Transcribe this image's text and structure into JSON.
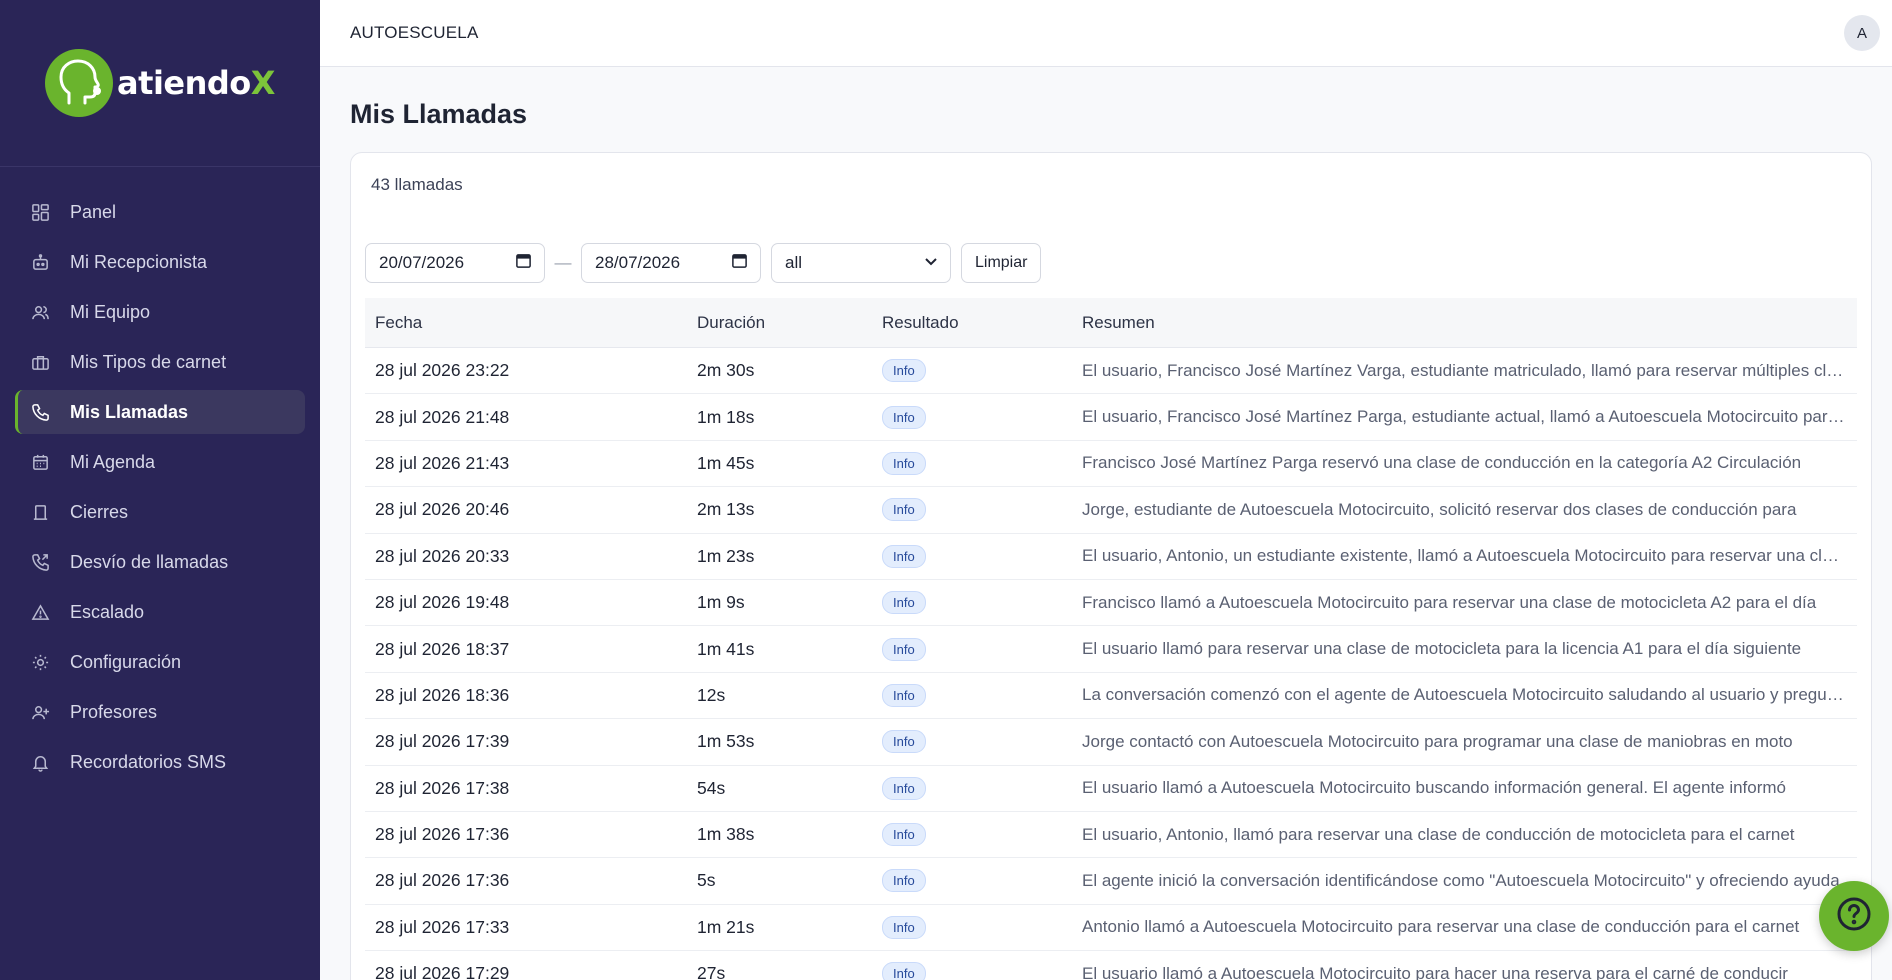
{
  "brand": {
    "name_main": "atiendo",
    "name_accent": "X",
    "accent_color": "#6ab42d",
    "sidebar_bg": "#2a2557"
  },
  "sidebar": {
    "items": [
      {
        "label": "Panel",
        "icon": "dashboard-grid-icon",
        "active": false
      },
      {
        "label": "Mi Recepcionista",
        "icon": "robot-icon",
        "active": false
      },
      {
        "label": "Mi Equipo",
        "icon": "users-icon",
        "active": false
      },
      {
        "label": "Mis Tipos de carnet",
        "icon": "briefcase-icon",
        "active": false
      },
      {
        "label": "Mis Llamadas",
        "icon": "phone-icon",
        "active": true
      },
      {
        "label": "Mi Agenda",
        "icon": "calendar-icon",
        "active": false
      },
      {
        "label": "Cierres",
        "icon": "building-icon",
        "active": false
      },
      {
        "label": "Desvío de llamadas",
        "icon": "phone-forward-icon",
        "active": false
      },
      {
        "label": "Escalado",
        "icon": "warning-triangle-icon",
        "active": false
      },
      {
        "label": "Configuración",
        "icon": "gear-icon",
        "active": false
      },
      {
        "label": "Profesores",
        "icon": "user-plus-icon",
        "active": false
      },
      {
        "label": "Recordatorios SMS",
        "icon": "bell-icon",
        "active": false
      }
    ]
  },
  "header": {
    "org_name": "AUTOESCUELA",
    "avatar_initial": "A"
  },
  "main": {
    "title": "Mis Llamadas",
    "count_label": "43 llamadas",
    "filters": {
      "date_from": "20/07/2026",
      "date_to": "28/07/2026",
      "separator": "—",
      "result_select": "all",
      "clear_label": "Limpiar"
    },
    "table": {
      "headers": [
        "Fecha",
        "Duración",
        "Resultado",
        "Resumen"
      ],
      "rows": [
        {
          "fecha": "28 jul 2026 23:22",
          "duracion": "2m 30s",
          "resultado": "Info",
          "resumen": "El usuario, Francisco José Martínez Varga, estudiante matriculado, llamó para reservar múltiples clases de conducción"
        },
        {
          "fecha": "28 jul 2026 21:48",
          "duracion": "1m 18s",
          "resultado": "Info",
          "resumen": "El usuario, Francisco José Martínez Parga, estudiante actual, llamó a Autoescuela Motocircuito para reservar"
        },
        {
          "fecha": "28 jul 2026 21:43",
          "duracion": "1m 45s",
          "resultado": "Info",
          "resumen": "Francisco José Martínez Parga reservó una clase de conducción en la categoría A2 Circulación"
        },
        {
          "fecha": "28 jul 2026 20:46",
          "duracion": "2m 13s",
          "resultado": "Info",
          "resumen": "Jorge, estudiante de Autoescuela Motocircuito, solicitó reservar dos clases de conducción para"
        },
        {
          "fecha": "28 jul 2026 20:33",
          "duracion": "1m 23s",
          "resultado": "Info",
          "resumen": "El usuario, Antonio, un estudiante existente, llamó a Autoescuela Motocircuito para reservar una clase"
        },
        {
          "fecha": "28 jul 2026 19:48",
          "duracion": "1m 9s",
          "resultado": "Info",
          "resumen": "Francisco llamó a Autoescuela Motocircuito para reservar una clase de motocicleta A2 para el día"
        },
        {
          "fecha": "28 jul 2026 18:37",
          "duracion": "1m 41s",
          "resultado": "Info",
          "resumen": "El usuario llamó para reservar una clase de motocicleta para la licencia A1 para el día siguiente"
        },
        {
          "fecha": "28 jul 2026 18:36",
          "duracion": "12s",
          "resultado": "Info",
          "resumen": "La conversación comenzó con el agente de Autoescuela Motocircuito saludando al usuario y preguntando"
        },
        {
          "fecha": "28 jul 2026 17:39",
          "duracion": "1m 53s",
          "resultado": "Info",
          "resumen": "Jorge contactó con Autoescuela Motocircuito para programar una clase de maniobras en moto"
        },
        {
          "fecha": "28 jul 2026 17:38",
          "duracion": "54s",
          "resultado": "Info",
          "resumen": "El usuario llamó a Autoescuela Motocircuito buscando información general. El agente informó"
        },
        {
          "fecha": "28 jul 2026 17:36",
          "duracion": "1m 38s",
          "resultado": "Info",
          "resumen": "El usuario, Antonio, llamó para reservar una clase de conducción de motocicleta para el carnet"
        },
        {
          "fecha": "28 jul 2026 17:36",
          "duracion": "5s",
          "resultado": "Info",
          "resumen": "El agente inició la conversación identificándose como \"Autoescuela Motocircuito\" y ofreciendo ayuda"
        },
        {
          "fecha": "28 jul 2026 17:33",
          "duracion": "1m 21s",
          "resultado": "Info",
          "resumen": "Antonio llamó a Autoescuela Motocircuito para reservar una clase de conducción para el carnet"
        },
        {
          "fecha": "28 jul 2026 17:29",
          "duracion": "27s",
          "resultado": "Info",
          "resumen": "El usuario llamó a Autoescuela Motocircuito para hacer una reserva para el carné de conducir"
        }
      ]
    }
  },
  "help_button": {
    "icon": "help-circle-icon"
  }
}
